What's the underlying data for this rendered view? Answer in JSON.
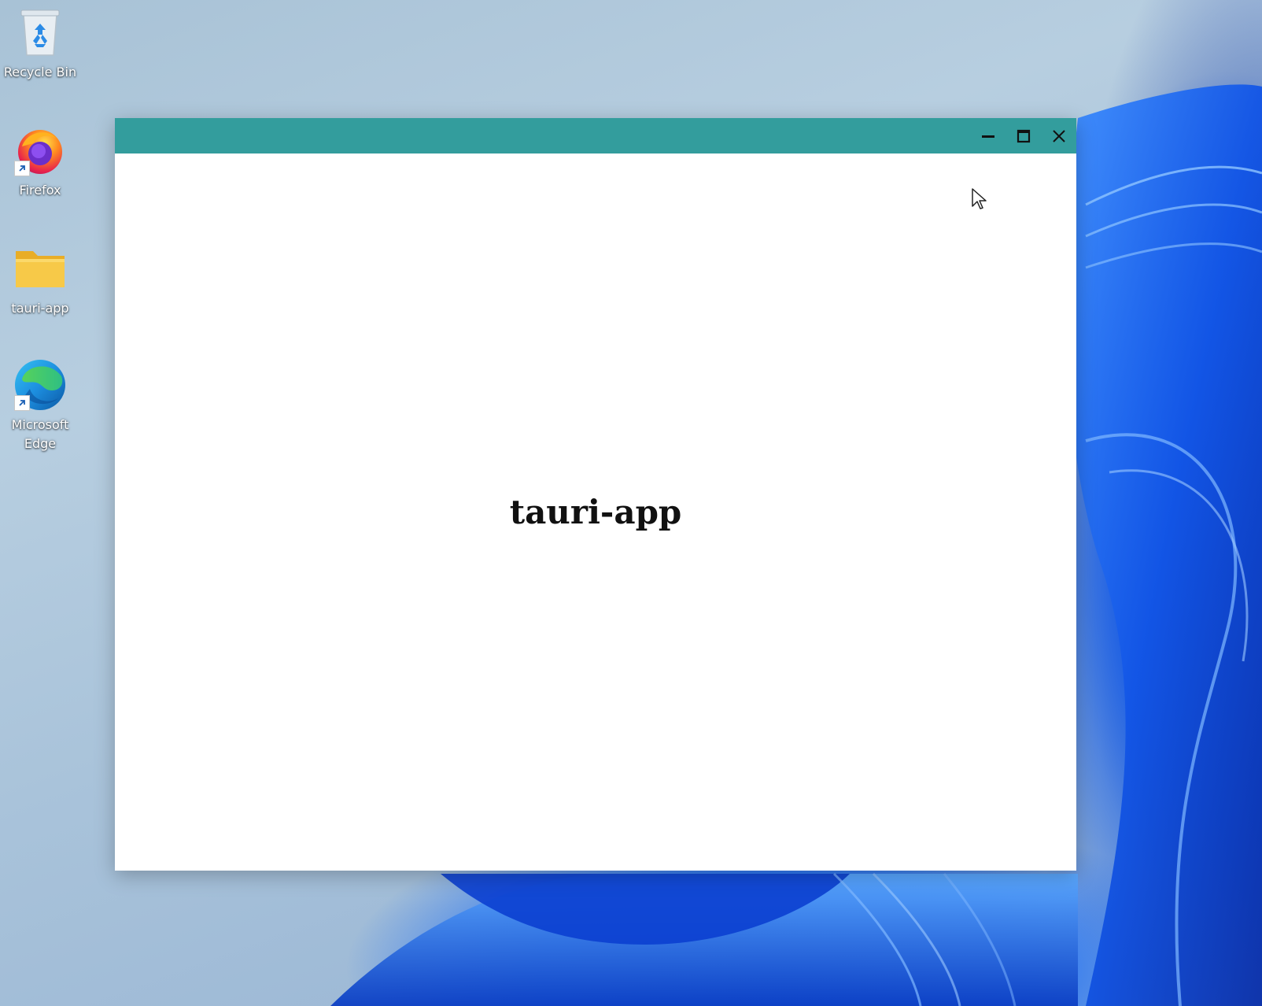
{
  "desktop": {
    "icons": [
      {
        "label": "Recycle Bin",
        "icon": "recycle-bin-icon"
      },
      {
        "label": "Firefox",
        "icon": "firefox-icon",
        "shortcut": true
      },
      {
        "label": "tauri-app",
        "icon": "folder-icon"
      },
      {
        "label": "Microsoft Edge",
        "icon": "edge-icon",
        "shortcut": true
      }
    ]
  },
  "window": {
    "title_bar_color": "#339d9d",
    "controls": [
      "minimize-icon",
      "maximize-icon",
      "close-icon"
    ],
    "heading": "tauri-app"
  },
  "colors": {
    "content_background": "#ffffff",
    "folder_yellow": "#f7c948"
  }
}
